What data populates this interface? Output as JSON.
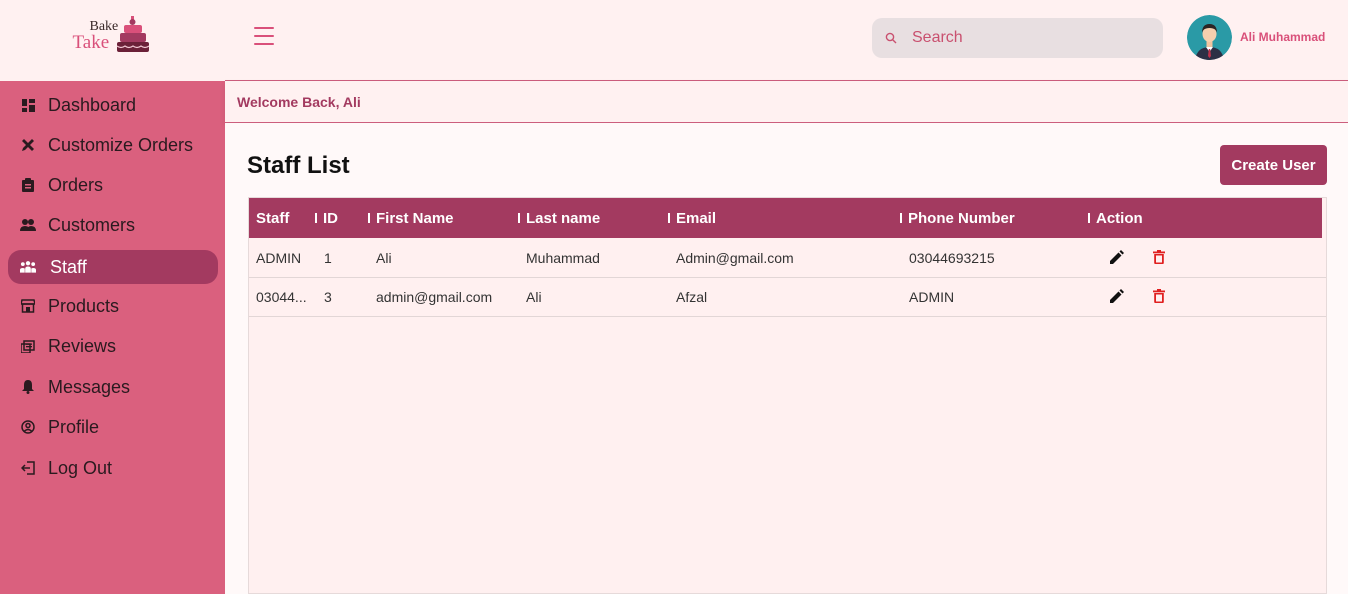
{
  "brand": {
    "line1": "Bake",
    "line2": "Take"
  },
  "sidebar": {
    "items": [
      {
        "label": "Dashboard",
        "icon": "dashboard-icon"
      },
      {
        "label": "Customize Orders",
        "icon": "tools-icon"
      },
      {
        "label": "Orders",
        "icon": "clipboard-icon"
      },
      {
        "label": "Customers",
        "icon": "people-icon"
      },
      {
        "label": "Staff",
        "icon": "staff-icon",
        "active": true
      },
      {
        "label": "Products",
        "icon": "store-icon"
      },
      {
        "label": "Reviews",
        "icon": "reviews-icon"
      },
      {
        "label": "Messages",
        "icon": "bell-icon"
      },
      {
        "label": "Profile",
        "icon": "profile-icon"
      },
      {
        "label": "Log Out",
        "icon": "logout-icon"
      }
    ]
  },
  "header": {
    "search_placeholder": "Search",
    "user_name": "Ali Muhammad"
  },
  "welcome": "Welcome Back, Ali",
  "page": {
    "title": "Staff List",
    "create_button": "Create User"
  },
  "table": {
    "columns": [
      "Staff",
      "ID",
      "First Name",
      "Last name",
      "Email",
      "Phone Number",
      "Action"
    ],
    "rows": [
      [
        "ADMIN",
        "1",
        "Ali",
        "Muhammad",
        "Admin@gmail.com",
        "03044693215"
      ],
      [
        "03044...",
        "3",
        "admin@gmail.com",
        "Ali",
        "Afzal",
        "ADMIN"
      ]
    ]
  },
  "colors": {
    "sidebar": "#da607e",
    "accent": "#a33a60",
    "header_bg": "#fff1f1",
    "delete": "#e02020"
  }
}
